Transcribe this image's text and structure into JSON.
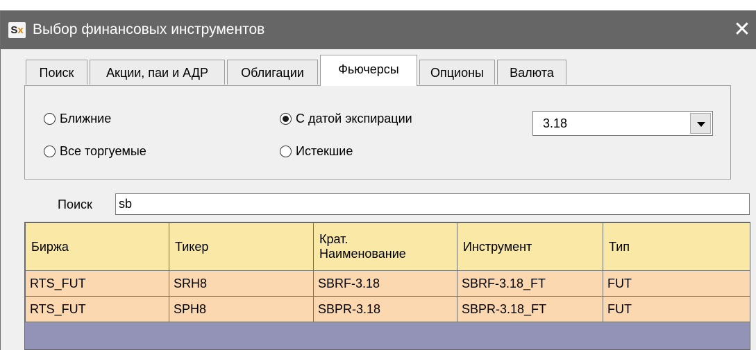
{
  "window": {
    "icon_text_main": "S",
    "icon_text_accent": "x",
    "title": "Выбор финансовых инструментов",
    "close_glyph": "✕"
  },
  "tabs": [
    {
      "label": "Поиск",
      "active": false
    },
    {
      "label": "Акции, паи и АДР",
      "active": false
    },
    {
      "label": "Облигации",
      "active": false
    },
    {
      "label": "Фьючерсы",
      "active": true
    },
    {
      "label": "Опционы",
      "active": false
    },
    {
      "label": "Валюта",
      "active": false
    }
  ],
  "filters": {
    "near": {
      "label": "Ближние",
      "checked": false
    },
    "all_traded": {
      "label": "Все торгуемые",
      "checked": false
    },
    "with_expiration": {
      "label": "С датой экспирации",
      "checked": true
    },
    "expired": {
      "label": "Истекшие",
      "checked": false
    },
    "expiration_select": {
      "value": "3.18",
      "icon": "dropdown-arrow-icon"
    }
  },
  "search": {
    "label": "Поиск",
    "value": "sb"
  },
  "grid": {
    "columns": [
      "Биржа",
      "Тикер",
      "Крат.\nНаименование",
      "Инструмент",
      "Тип"
    ],
    "rows": [
      [
        "RTS_FUT",
        "SRH8",
        "SBRF-3.18",
        "SBRF-3.18_FT",
        "FUT"
      ],
      [
        "RTS_FUT",
        "SPH8",
        "SBPR-3.18",
        "SBPR-3.18_FT",
        "FUT"
      ]
    ]
  },
  "colors": {
    "titlebar": "#666666",
    "header_row": "#fae8a6",
    "data_row": "#fbd8b0",
    "grid_background": "#9293b6"
  }
}
